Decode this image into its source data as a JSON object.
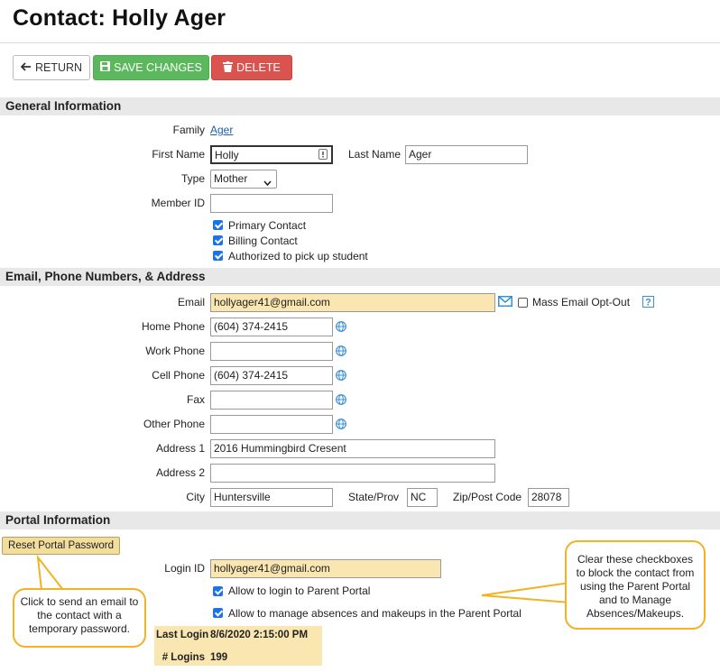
{
  "page": {
    "title": "Contact: Holly Ager"
  },
  "toolbar": {
    "return_label": "RETURN",
    "save_label": "SAVE CHANGES",
    "delete_label": "DELETE"
  },
  "general": {
    "heading": "General Information",
    "family_label": "Family",
    "family_value": "Ager",
    "first_name_label": "First Name",
    "first_name": "Holly",
    "last_name_label": "Last Name",
    "last_name": "Ager",
    "type_label": "Type",
    "type_value": "Mother",
    "member_id_label": "Member ID",
    "member_id": "",
    "checks": [
      {
        "label": "Primary Contact",
        "checked": true
      },
      {
        "label": "Billing Contact",
        "checked": true
      },
      {
        "label": "Authorized to pick up student",
        "checked": true
      }
    ]
  },
  "contact": {
    "heading": "Email, Phone Numbers, & Address",
    "email_label": "Email",
    "email": "hollyager41@gmail.com",
    "opt_out_label": "Mass Email Opt-Out",
    "home_phone_label": "Home Phone",
    "home_phone": "(604) 374-2415",
    "work_phone_label": "Work Phone",
    "work_phone": "",
    "cell_phone_label": "Cell Phone",
    "cell_phone": "(604) 374-2415",
    "fax_label": "Fax",
    "fax": "",
    "other_phone_label": "Other Phone",
    "other_phone": "",
    "address1_label": "Address 1",
    "address1": "2016 Hummingbird Cresent",
    "address2_label": "Address 2",
    "address2": "",
    "city_label": "City",
    "city": "Huntersville",
    "state_label": "State/Prov",
    "state": "NC",
    "zip_label": "Zip/Post Code",
    "zip": "28078"
  },
  "portal": {
    "heading": "Portal Information",
    "reset_label": "Reset Portal Password",
    "login_id_label": "Login ID",
    "login_id": "hollyager41@gmail.com",
    "allow_login_label": "Allow to login to Parent Portal",
    "allow_manage_label": "Allow to manage absences and makeups in the Parent Portal",
    "last_login_label": "Last Login",
    "last_login": "8/6/2020 2:15:00 PM",
    "logins_label": "# Logins",
    "logins": "199"
  },
  "callouts": {
    "left": "Click to send an email to the contact with a temporary password.",
    "right": "Clear these checkboxes to block the contact from using the Parent Portal and to Manage Absences/Makeups."
  },
  "colors": {
    "save": "#5cb85c",
    "delete": "#d9534f",
    "highlight": "#fae6b0",
    "callout_border": "#f0b323",
    "link": "#1f5fa8"
  }
}
